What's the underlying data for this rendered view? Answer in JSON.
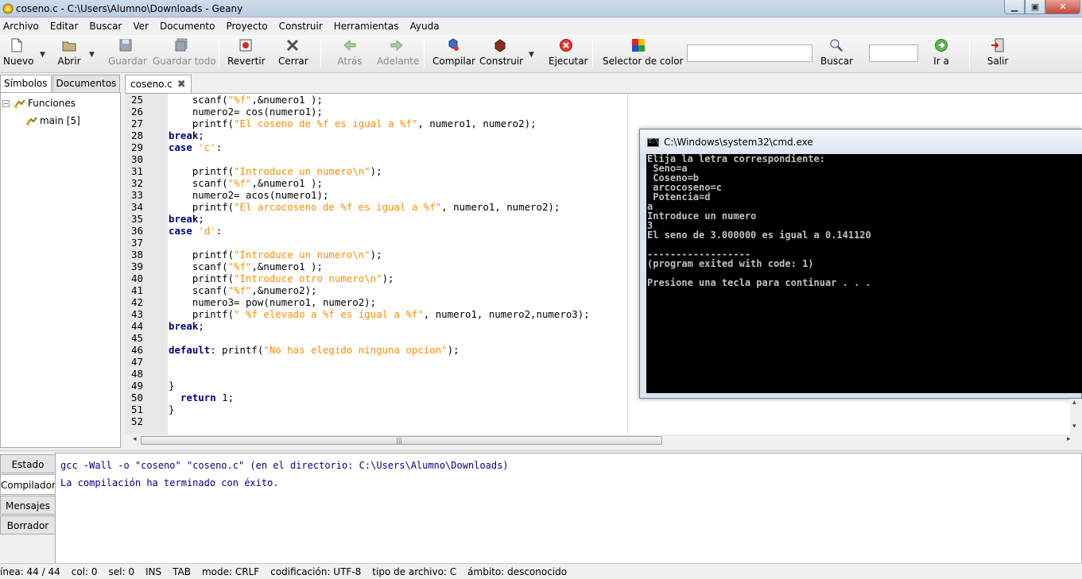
{
  "window": {
    "title": "coseno.c - C:\\Users\\Alumno\\Downloads - Geany",
    "minimize_glyph": "▁",
    "maximize_glyph": "▣",
    "close_glyph": "✕"
  },
  "menu": [
    "Archivo",
    "Editar",
    "Buscar",
    "Ver",
    "Documento",
    "Proyecto",
    "Construir",
    "Herramientas",
    "Ayuda"
  ],
  "toolbar": {
    "nuevo": "Nuevo",
    "abrir": "Abrir",
    "guardar": "Guardar",
    "guardar_todo": "Guardar todo",
    "revertir": "Revertir",
    "cerrar": "Cerrar",
    "atras": "Atrás",
    "adelante": "Adelante",
    "compilar": "Compilar",
    "construir": "Construir",
    "ejecutar": "Ejecutar",
    "selector_color": "Selector de color",
    "search_value": "",
    "buscar": "Buscar",
    "goto_value": "",
    "ir_a": "Ir a",
    "salir": "Salir",
    "drop_glyph": "▼"
  },
  "sidebar": {
    "tab_symbols": "Símbolos",
    "tab_documents": "Documentos",
    "tree_toggle": "−",
    "group_label": "Funciones",
    "item_label": "main [5]"
  },
  "editor": {
    "tab_label": "coseno.c",
    "tab_close": "✖",
    "lines": [
      {
        "n": "25",
        "code": [
          [
            "p",
            "    scanf("
          ],
          [
            "s",
            "\"%f\""
          ],
          [
            "p",
            ",&numero1 );"
          ]
        ]
      },
      {
        "n": "26",
        "code": [
          [
            "p",
            "    numero2= cos(numero1);"
          ]
        ]
      },
      {
        "n": "27",
        "code": [
          [
            "p",
            "    printf("
          ],
          [
            "s",
            "\"El coseno de %f es igual a %f\""
          ],
          [
            "p",
            ", numero1, numero2);"
          ]
        ]
      },
      {
        "n": "28",
        "code": [
          [
            "k",
            "break"
          ],
          [
            "p",
            ";"
          ]
        ]
      },
      {
        "n": "29",
        "code": [
          [
            "k",
            "case"
          ],
          [
            "p",
            " "
          ],
          [
            "s",
            "'c'"
          ],
          [
            "p",
            ":"
          ]
        ]
      },
      {
        "n": "30",
        "code": []
      },
      {
        "n": "31",
        "code": [
          [
            "p",
            "    printf("
          ],
          [
            "s",
            "\"Introduce un numero\\n\""
          ],
          [
            "p",
            ");"
          ]
        ]
      },
      {
        "n": "32",
        "code": [
          [
            "p",
            "    scanf("
          ],
          [
            "s",
            "\"%f\""
          ],
          [
            "p",
            ",&numero1 );"
          ]
        ]
      },
      {
        "n": "33",
        "code": [
          [
            "p",
            "    numero2= acos(numero1);"
          ]
        ]
      },
      {
        "n": "34",
        "code": [
          [
            "p",
            "    printf("
          ],
          [
            "s",
            "\"El arcocoseno de %f es igual a %f\""
          ],
          [
            "p",
            ", numero1, numero2);"
          ]
        ]
      },
      {
        "n": "35",
        "code": [
          [
            "k",
            "break"
          ],
          [
            "p",
            ";"
          ]
        ]
      },
      {
        "n": "36",
        "code": [
          [
            "k",
            "case"
          ],
          [
            "p",
            " "
          ],
          [
            "s",
            "'d'"
          ],
          [
            "p",
            ":"
          ]
        ]
      },
      {
        "n": "37",
        "code": []
      },
      {
        "n": "38",
        "code": [
          [
            "p",
            "    printf("
          ],
          [
            "s",
            "\"Introduce un numero\\n\""
          ],
          [
            "p",
            ");"
          ]
        ]
      },
      {
        "n": "39",
        "code": [
          [
            "p",
            "    scanf("
          ],
          [
            "s",
            "\"%f\""
          ],
          [
            "p",
            ",&numero1 );"
          ]
        ]
      },
      {
        "n": "40",
        "code": [
          [
            "p",
            "    printf("
          ],
          [
            "s",
            "\"Introduce otro numero\\n\""
          ],
          [
            "p",
            ");"
          ]
        ]
      },
      {
        "n": "41",
        "code": [
          [
            "p",
            "    scanf("
          ],
          [
            "s",
            "\"%f\""
          ],
          [
            "p",
            ",&numero2);"
          ]
        ]
      },
      {
        "n": "42",
        "code": [
          [
            "p",
            "    numero3= pow(numero1, numero2);"
          ]
        ]
      },
      {
        "n": "43",
        "code": [
          [
            "p",
            "    printf("
          ],
          [
            "s",
            "\" %f elevado a %f es igual a %f\""
          ],
          [
            "p",
            ", numero1, numero2,numero3);"
          ]
        ]
      },
      {
        "n": "44",
        "code": [
          [
            "k",
            "break"
          ],
          [
            "p",
            ";"
          ]
        ]
      },
      {
        "n": "45",
        "code": []
      },
      {
        "n": "46",
        "code": [
          [
            "k",
            "default"
          ],
          [
            "p",
            ": printf("
          ],
          [
            "s",
            "\"No has elegido ninguna opcion\""
          ],
          [
            "p",
            ");"
          ]
        ]
      },
      {
        "n": "47",
        "code": []
      },
      {
        "n": "48",
        "code": []
      },
      {
        "n": "49",
        "code": [
          [
            "p",
            "}"
          ]
        ]
      },
      {
        "n": "50",
        "code": [
          [
            "p",
            "  "
          ],
          [
            "k",
            "return"
          ],
          [
            "p",
            " "
          ],
          [
            "n",
            "1"
          ],
          [
            "p",
            ";"
          ]
        ]
      },
      {
        "n": "51",
        "code": [
          [
            "p",
            "}"
          ]
        ]
      },
      {
        "n": "52",
        "code": []
      }
    ],
    "scroll_grip": "|||",
    "scroll_left": "◂",
    "scroll_right": "▸"
  },
  "cmd": {
    "title": "C:\\Windows\\system32\\cmd.exe",
    "icon_text": "C:\\",
    "lines": [
      "Elija la letra correspondiente:",
      " Seno=a",
      " Coseno=b",
      " arcocoseno=c",
      " Potencia=d",
      "a",
      "Introduce un numero",
      "3",
      "El seno de 3.000000 es igual a 0.141120",
      "",
      "------------------",
      "(program exited with code: 1)",
      "",
      "Presione una tecla para continuar . . ."
    ],
    "scroll_up": "▴",
    "scroll_down": "▾"
  },
  "messages": {
    "tabs": [
      "Estado",
      "Compilador",
      "Mensajes",
      "Borrador"
    ],
    "active_tab": "Compilador",
    "lines": [
      "gcc -Wall -o \"coseno\" \"coseno.c\" (en el directorio: C:\\Users\\Alumno\\Downloads)",
      "La compilación ha terminado con éxito."
    ]
  },
  "status": {
    "linea": "ínea: 44 / 44",
    "col": "col: 0",
    "sel": "sel: 0",
    "ins": "INS",
    "tab": "TAB",
    "mode": "mode: CRLF",
    "encoding": "codificación: UTF-8",
    "filetype": "tipo de archivo: C",
    "scope": "ámbito: desconocido"
  },
  "colors": {
    "keyword": "#00007f",
    "string": "#ff8c00",
    "message_text": "#00007f"
  }
}
